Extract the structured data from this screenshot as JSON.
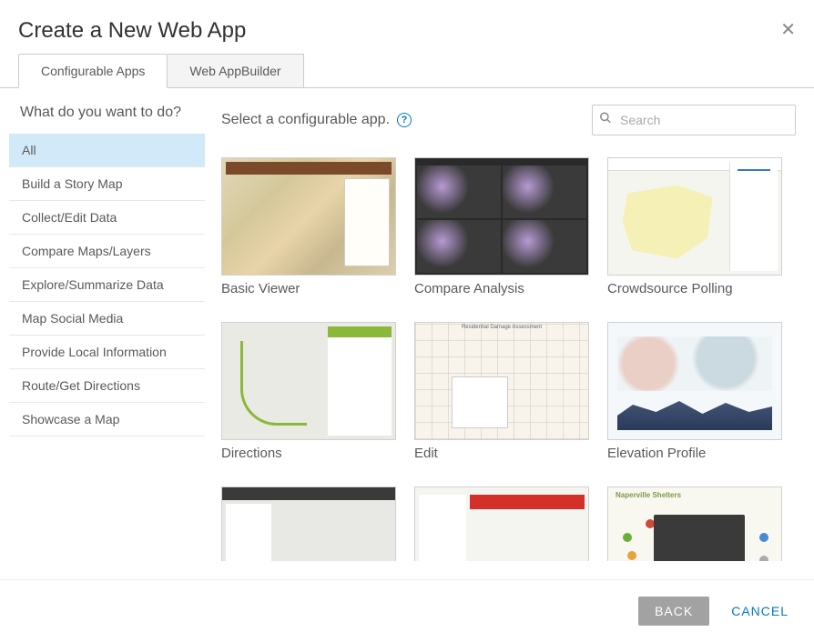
{
  "header": {
    "title": "Create a New Web App"
  },
  "tabs": [
    {
      "label": "Configurable Apps",
      "active": true
    },
    {
      "label": "Web AppBuilder",
      "active": false
    }
  ],
  "sidebar": {
    "title": "What do you want to do?",
    "categories": [
      "All",
      "Build a Story Map",
      "Collect/Edit Data",
      "Compare Maps/Layers",
      "Explore/Summarize Data",
      "Map Social Media",
      "Provide Local Information",
      "Route/Get Directions",
      "Showcase a Map"
    ],
    "active_index": 0
  },
  "main": {
    "subtitle": "Select a configurable app.",
    "search_placeholder": "Search",
    "apps": [
      {
        "label": "Basic Viewer",
        "thumb": "t-basic"
      },
      {
        "label": "Compare Analysis",
        "thumb": "t-compare"
      },
      {
        "label": "Crowdsource Polling",
        "thumb": "t-crowd"
      },
      {
        "label": "Directions",
        "thumb": "t-dir"
      },
      {
        "label": "Edit",
        "thumb": "t-edit"
      },
      {
        "label": "Elevation Profile",
        "thumb": "t-elev"
      },
      {
        "label": "",
        "thumb": "t-dark"
      },
      {
        "label": "",
        "thumb": "t-red"
      },
      {
        "label": "",
        "thumb": "t-nap"
      }
    ]
  },
  "footer": {
    "back": "BACK",
    "cancel": "CANCEL"
  }
}
